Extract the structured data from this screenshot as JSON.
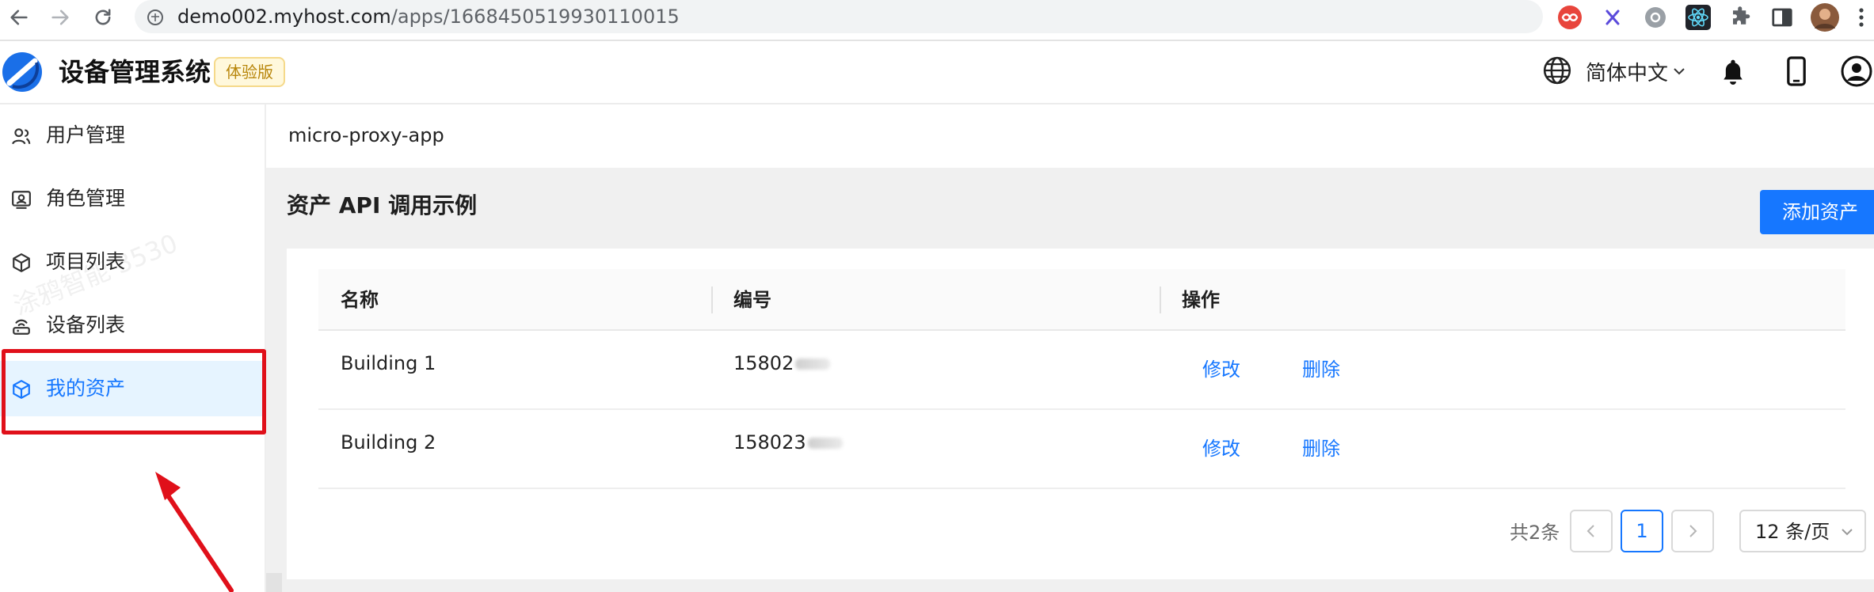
{
  "browser": {
    "url_host": "demo002.myhost.com",
    "url_path": "/apps/1668450519930110015",
    "extensions": [
      "infinity-ext-icon",
      "x-ext-icon",
      "gear-ext-icon",
      "react-devtools-icon",
      "puzzle-icon",
      "sidebar-toggle-icon",
      "profile-avatar-icon",
      "more-vertical-icon"
    ]
  },
  "header": {
    "title": "设备管理系统",
    "badge": "体验版",
    "language": "简体中文"
  },
  "sidebar": {
    "items": [
      {
        "label": "用户管理",
        "icon": "user-icon"
      },
      {
        "label": "角色管理",
        "icon": "role-card-icon"
      },
      {
        "label": "项目列表",
        "icon": "cube-icon"
      },
      {
        "label": "设备列表",
        "icon": "device-icon"
      },
      {
        "label": "我的资产",
        "icon": "asset-cube-icon",
        "active": true
      }
    ]
  },
  "content": {
    "breadcrumb": "micro-proxy-app",
    "title": "资产 API 调用示例",
    "add_button": "添加资产",
    "table": {
      "columns": [
        "名称",
        "编号",
        "操作"
      ],
      "rows": [
        {
          "name": "Building 1",
          "code": "15802"
        },
        {
          "name": "Building 2",
          "code": "158023"
        }
      ],
      "actions": {
        "edit": "修改",
        "delete": "删除"
      }
    },
    "pagination": {
      "total": "共2条",
      "current_page": "1",
      "page_size": "12 条/页"
    }
  },
  "colors": {
    "primary": "#1677ff",
    "highlight": "#e0101a",
    "badge_bg": "#fff8dc",
    "badge_text": "#b8860b"
  }
}
